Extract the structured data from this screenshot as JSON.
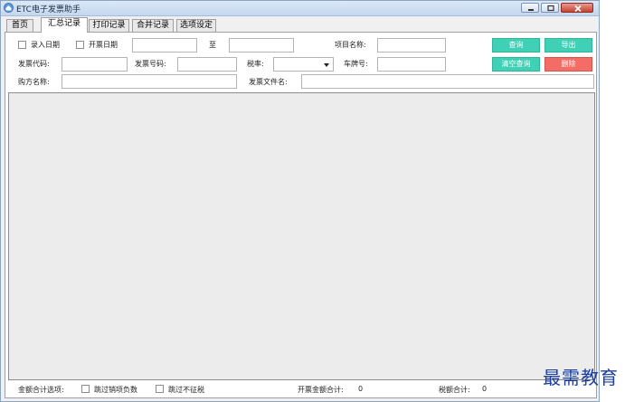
{
  "window": {
    "title": "ETC电子发票助手"
  },
  "tabs": [
    {
      "label": "首页"
    },
    {
      "label": "汇总记录"
    },
    {
      "label": "打印记录"
    },
    {
      "label": "合并记录"
    },
    {
      "label": "选项设定"
    }
  ],
  "filters": {
    "entry_date_label": "录入日期",
    "invoice_date_label": "开票日期",
    "to_label": "至",
    "item_name_label": "项目名称:",
    "invoice_code_label": "发票代码:",
    "invoice_number_label": "发票号码:",
    "tax_rate_label": "税率:",
    "plate_label": "车牌号:",
    "buyer_label": "购方名称:",
    "filename_label": "发票文件名:"
  },
  "buttons": {
    "query": "查询",
    "export": "导出",
    "clear_query": "清空查询",
    "delete": "删除"
  },
  "footer": {
    "options_label": "金额合计选项:",
    "skip_negative_label": "跳过销项负数",
    "skip_no_tax_label": "跳过不征税",
    "invoice_total_label": "开票金额合计:",
    "invoice_total_value": "0",
    "tax_total_label": "税额合计:",
    "tax_total_value": "0"
  },
  "watermark": "最需教育",
  "colors": {
    "teal_button": "#3fd0b6",
    "red_button": "#f26d65"
  }
}
